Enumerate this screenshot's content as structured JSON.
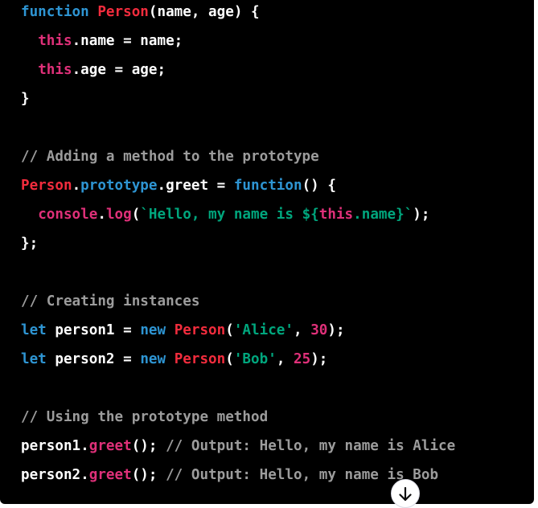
{
  "code": {
    "lines": [
      [
        {
          "t": "keyword",
          "v": "function"
        },
        {
          "t": "plain",
          "v": " "
        },
        {
          "t": "class",
          "v": "Person"
        },
        {
          "t": "plain",
          "v": "(name, age) {"
        }
      ],
      [
        {
          "t": "plain",
          "v": "  "
        },
        {
          "t": "this",
          "v": "this"
        },
        {
          "t": "plain",
          "v": ".name = name;"
        }
      ],
      [
        {
          "t": "plain",
          "v": "  "
        },
        {
          "t": "this",
          "v": "this"
        },
        {
          "t": "plain",
          "v": ".age = age;"
        }
      ],
      [
        {
          "t": "plain",
          "v": "}"
        }
      ],
      [],
      [
        {
          "t": "comment",
          "v": "// Adding a method to the prototype"
        }
      ],
      [
        {
          "t": "class",
          "v": "Person"
        },
        {
          "t": "plain",
          "v": "."
        },
        {
          "t": "prop",
          "v": "prototype"
        },
        {
          "t": "plain",
          "v": ".greet = "
        },
        {
          "t": "keyword",
          "v": "function"
        },
        {
          "t": "plain",
          "v": "() {"
        }
      ],
      [
        {
          "t": "plain",
          "v": "  "
        },
        {
          "t": "call",
          "v": "console"
        },
        {
          "t": "plain",
          "v": "."
        },
        {
          "t": "call",
          "v": "log"
        },
        {
          "t": "plain",
          "v": "("
        },
        {
          "t": "string",
          "v": "`Hello, my name is ${"
        },
        {
          "t": "this",
          "v": "this"
        },
        {
          "t": "string",
          "v": ".name}`"
        },
        {
          "t": "plain",
          "v": ");"
        }
      ],
      [
        {
          "t": "plain",
          "v": "};"
        }
      ],
      [],
      [
        {
          "t": "comment",
          "v": "// Creating instances"
        }
      ],
      [
        {
          "t": "keyword",
          "v": "let"
        },
        {
          "t": "plain",
          "v": " person1 = "
        },
        {
          "t": "keyword",
          "v": "new"
        },
        {
          "t": "plain",
          "v": " "
        },
        {
          "t": "class",
          "v": "Person"
        },
        {
          "t": "plain",
          "v": "("
        },
        {
          "t": "string",
          "v": "'Alice'"
        },
        {
          "t": "plain",
          "v": ", "
        },
        {
          "t": "number",
          "v": "30"
        },
        {
          "t": "plain",
          "v": ");"
        }
      ],
      [
        {
          "t": "keyword",
          "v": "let"
        },
        {
          "t": "plain",
          "v": " person2 = "
        },
        {
          "t": "keyword",
          "v": "new"
        },
        {
          "t": "plain",
          "v": " "
        },
        {
          "t": "class",
          "v": "Person"
        },
        {
          "t": "plain",
          "v": "("
        },
        {
          "t": "string",
          "v": "'Bob'"
        },
        {
          "t": "plain",
          "v": ", "
        },
        {
          "t": "number",
          "v": "25"
        },
        {
          "t": "plain",
          "v": ");"
        }
      ],
      [],
      [
        {
          "t": "comment",
          "v": "// Using the prototype method"
        }
      ],
      [
        {
          "t": "plain",
          "v": "person1."
        },
        {
          "t": "call",
          "v": "greet"
        },
        {
          "t": "plain",
          "v": "(); "
        },
        {
          "t": "comment",
          "v": "// Output: Hello, my name is Alice"
        }
      ],
      [
        {
          "t": "plain",
          "v": "person2."
        },
        {
          "t": "call",
          "v": "greet"
        },
        {
          "t": "plain",
          "v": "(); "
        },
        {
          "t": "comment",
          "v": "// Output: Hello, my name is Bob"
        }
      ]
    ]
  },
  "colors": {
    "background": "#000000",
    "keyword": "#2e95d3",
    "class": "#f22c3d",
    "this": "#df3079",
    "string": "#00a67d",
    "number": "#df3079",
    "comment": "#9c9c9c",
    "plain": "#ffffff"
  },
  "scroll_button": {
    "icon": "arrow-down-icon"
  }
}
